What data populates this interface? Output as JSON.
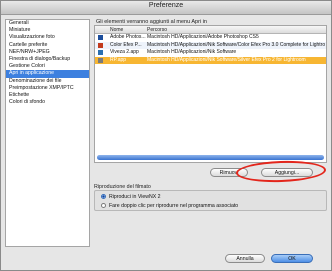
{
  "window": {
    "title": "Preferenze"
  },
  "sidebar": {
    "items": [
      {
        "label": "Generali",
        "selected": false
      },
      {
        "label": "Miniature",
        "selected": false
      },
      {
        "label": "Visualizzazione foto",
        "selected": false
      },
      {
        "label": "Cartelle preferite",
        "selected": false
      },
      {
        "label": "NEF/NRW+JPEG",
        "selected": false
      },
      {
        "label": "Finestra di dialogo/Backup",
        "selected": false
      },
      {
        "label": "Gestione Colori",
        "selected": false
      },
      {
        "label": "Apri in applicazione",
        "selected": true
      },
      {
        "label": "Denominazione dei file",
        "selected": false
      },
      {
        "label": "Preimpostazione XMP/IPTC",
        "selected": false
      },
      {
        "label": "Etichette",
        "selected": false
      },
      {
        "label": "Colori di sfondo",
        "selected": false
      }
    ]
  },
  "main": {
    "heading": "Gli elementi verranno aggiunti al menu Apri in",
    "columns": [
      "Nome",
      "Percorso"
    ],
    "rows": [
      {
        "icon": "photoshop-icon",
        "name": "Adobe Photos...",
        "path": "Macintosh HD/Applicazioni/Adobe Photoshop CS5",
        "selected": false,
        "color": "#1c4e9c"
      },
      {
        "icon": "color-efex-icon",
        "name": "Color Efex P...",
        "path": "Macintosh HD/Applicazioni/Nik Software/Color Efex Pro 3.0 Complete for Lightro",
        "selected": false,
        "color": "#c23a1c"
      },
      {
        "icon": "viveza-icon",
        "name": "Viveza 2.app",
        "path": "Macintosh HD/Applicazioni/Nik Software",
        "selected": false,
        "color": "#2a6fb0"
      },
      {
        "icon": "app-icon",
        "name": "RP.app",
        "path": "Macintosh HD/Applicazioni/Nik Software/Silver Efex Pro 2 for Lightroom",
        "selected": true,
        "color": "#7a7a7a"
      }
    ],
    "remove_label": "Rimuovi",
    "add_label": "Aggiungi..."
  },
  "playback": {
    "label": "Riproduzione del filmato",
    "options": [
      {
        "label": "Riproduci in ViewNX 2",
        "checked": true
      },
      {
        "label": "Fare doppio clic per riprodurre nel programma associato",
        "checked": false
      }
    ]
  },
  "footer": {
    "cancel_label": "Annulla",
    "ok_label": "OK"
  }
}
